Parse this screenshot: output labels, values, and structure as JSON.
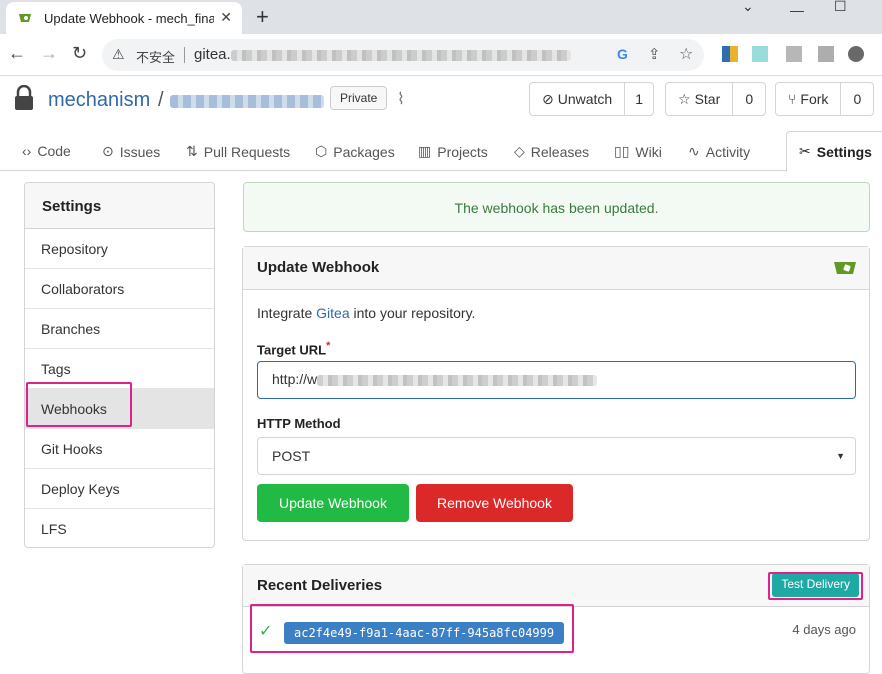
{
  "browser": {
    "tab_title": "Update Webhook - mech_final_parts",
    "insecure_label": "不安全",
    "url_visible": "gitea."
  },
  "repo": {
    "owner": "mechanism",
    "separator": "/",
    "visibility_badge": "Private",
    "unwatch_label": "Unwatch",
    "unwatch_count": "1",
    "star_label": "Star",
    "star_count": "0",
    "fork_label": "Fork",
    "fork_count": "0"
  },
  "tabs": [
    "Code",
    "Issues",
    "Pull Requests",
    "Packages",
    "Projects",
    "Releases",
    "Wiki",
    "Activity",
    "Settings"
  ],
  "sidebar": {
    "title": "Settings",
    "items": [
      "Repository",
      "Collaborators",
      "Branches",
      "Tags",
      "Webhooks",
      "Git Hooks",
      "Deploy Keys",
      "LFS"
    ],
    "active": "Webhooks"
  },
  "flash": "The webhook has been updated.",
  "form": {
    "title": "Update Webhook",
    "intro_prefix": "Integrate ",
    "intro_link": "Gitea",
    "intro_suffix": " into your repository.",
    "target_url_label": "Target URL",
    "required_mark": "*",
    "target_url_value": "http://w",
    "http_method_label": "HTTP Method",
    "http_method_value": "POST",
    "update_button": "Update Webhook",
    "remove_button": "Remove Webhook"
  },
  "deliveries": {
    "title": "Recent Deliveries",
    "test_button": "Test Delivery",
    "items": [
      {
        "id": "ac2f4e49-f9a1-4aac-87ff-945a8fc04999",
        "time": "4 days ago",
        "status": "success"
      }
    ]
  },
  "colors": {
    "link": "#2f6aa8",
    "success_button": "#21ba45",
    "danger_button": "#db2828",
    "highlight": "#e0218a",
    "teal": "#1fa9a4"
  }
}
